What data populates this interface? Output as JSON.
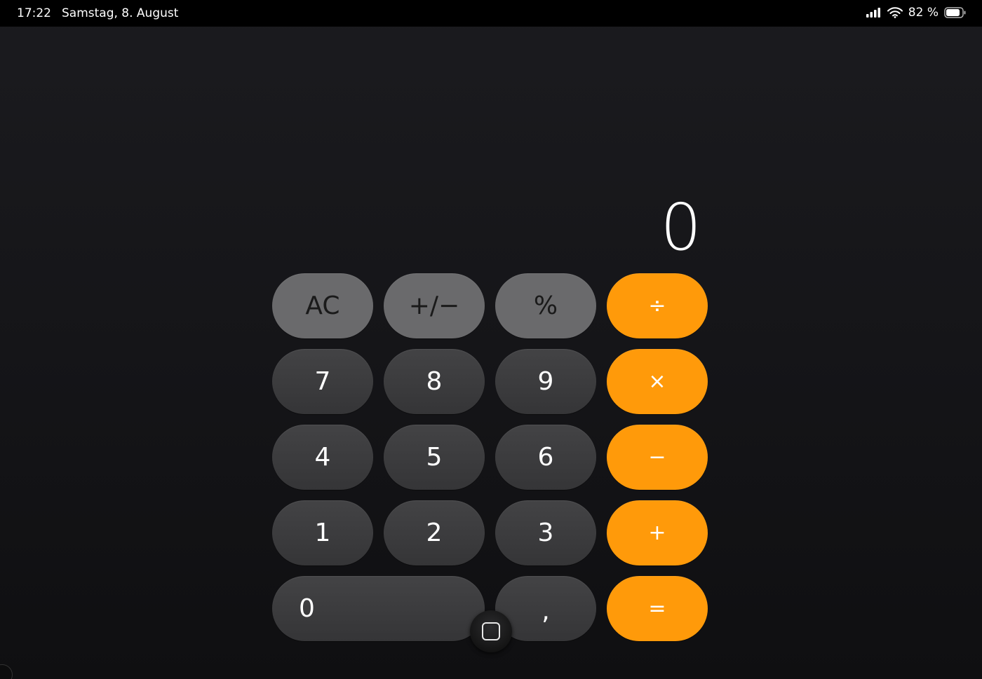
{
  "status_bar": {
    "time": "17:22",
    "date": "Samstag, 8. August",
    "battery_percent": "82 %",
    "signal_icon": "cellular-signal-icon",
    "wifi_icon": "wifi-icon",
    "battery_icon": "battery-icon"
  },
  "display": {
    "value": "0"
  },
  "keys": {
    "ac": "AC",
    "plus_minus": "+/−",
    "percent": "%",
    "divide": "÷",
    "seven": "7",
    "eight": "8",
    "nine": "9",
    "multiply": "×",
    "four": "4",
    "five": "5",
    "six": "6",
    "minus": "−",
    "one": "1",
    "two": "2",
    "three": "3",
    "plus": "+",
    "zero": "0",
    "comma": ",",
    "equals": "="
  },
  "colors": {
    "operator": "#ff9a0a",
    "function": "#6a6a6c",
    "number": "#3c3c3e",
    "background": "#141416"
  },
  "home_button_icon": "home-square-icon"
}
